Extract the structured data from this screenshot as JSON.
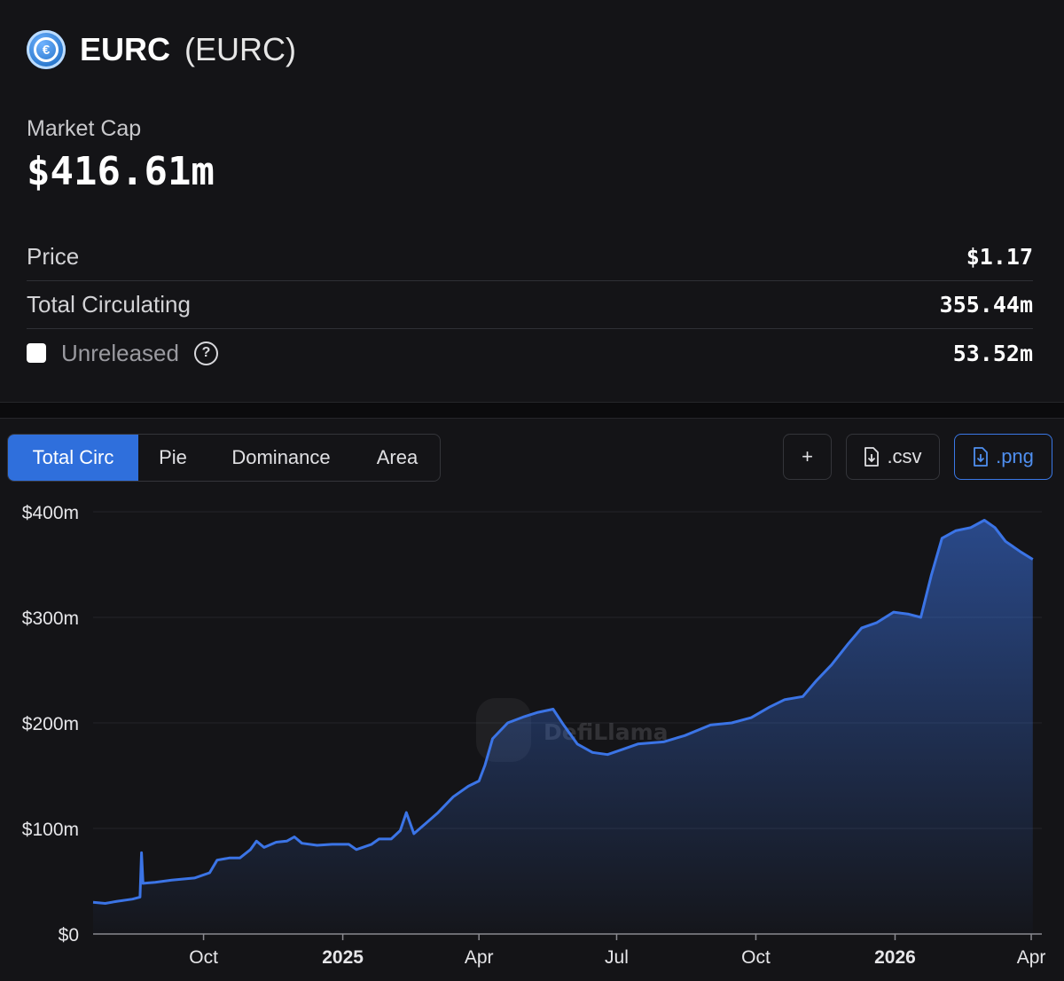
{
  "header": {
    "name": "EURC",
    "symbol": "(EURC)",
    "logo_glyph": "€",
    "brand_color": "#2775ca"
  },
  "market_cap": {
    "label": "Market Cap",
    "value": "$416.61m"
  },
  "stats": {
    "price": {
      "label": "Price",
      "value": "$1.17"
    },
    "total_circulating": {
      "label": "Total Circulating",
      "value": "355.44m"
    },
    "unreleased": {
      "label": "Unreleased",
      "value": "53.52m",
      "checked": false,
      "help_icon": "question-circle-icon"
    }
  },
  "tabs": [
    {
      "label": "Total Circ",
      "active": true
    },
    {
      "label": "Pie",
      "active": false
    },
    {
      "label": "Dominance",
      "active": false
    },
    {
      "label": "Area",
      "active": false
    }
  ],
  "actions": {
    "add_label": "+",
    "csv_label": ".csv",
    "png_label": ".png",
    "download_icon": "file-download-icon"
  },
  "watermark": "DefiLlama",
  "colors": {
    "accent": "#2f6fdc",
    "line": "#3b74e6",
    "background": "#141417"
  },
  "chart_data": {
    "type": "area",
    "ylim": [
      0,
      400
    ],
    "y_ticks": [
      "$0",
      "$100m",
      "$200m",
      "$300m",
      "$400m"
    ],
    "y_tick_values": [
      0,
      100,
      200,
      300,
      400
    ],
    "x_ticks": [
      {
        "label": "Oct",
        "date": "2024-10-01",
        "bold": false
      },
      {
        "label": "2025",
        "date": "2025-01-01",
        "bold": true
      },
      {
        "label": "Apr",
        "date": "2025-04-01",
        "bold": false
      },
      {
        "label": "Jul",
        "date": "2025-07-01",
        "bold": false
      },
      {
        "label": "Oct",
        "date": "2025-10-01",
        "bold": false
      },
      {
        "label": "2026",
        "date": "2026-01-01",
        "bold": true
      },
      {
        "label": "Apr",
        "date": "2026-04-01",
        "bold": false
      }
    ],
    "grid": true,
    "series": [
      {
        "values": [
          [
            "2024-07-20",
            30
          ],
          [
            "2024-07-28",
            29
          ],
          [
            "2024-08-05",
            31
          ],
          [
            "2024-08-15",
            33
          ],
          [
            "2024-08-20",
            35
          ],
          [
            "2024-08-21",
            77
          ],
          [
            "2024-08-22",
            48
          ],
          [
            "2024-08-30",
            49
          ],
          [
            "2024-09-10",
            51
          ],
          [
            "2024-09-25",
            53
          ],
          [
            "2024-10-05",
            58
          ],
          [
            "2024-10-10",
            70
          ],
          [
            "2024-10-18",
            72
          ],
          [
            "2024-10-25",
            72
          ],
          [
            "2024-11-01",
            80
          ],
          [
            "2024-11-05",
            88
          ],
          [
            "2024-11-10",
            82
          ],
          [
            "2024-11-18",
            87
          ],
          [
            "2024-11-25",
            88
          ],
          [
            "2024-11-30",
            92
          ],
          [
            "2024-12-05",
            86
          ],
          [
            "2024-12-15",
            84
          ],
          [
            "2024-12-25",
            85
          ],
          [
            "2025-01-05",
            85
          ],
          [
            "2025-01-10",
            80
          ],
          [
            "2025-01-20",
            85
          ],
          [
            "2025-01-25",
            90
          ],
          [
            "2025-02-02",
            90
          ],
          [
            "2025-02-08",
            98
          ],
          [
            "2025-02-12",
            115
          ],
          [
            "2025-02-17",
            95
          ],
          [
            "2025-02-25",
            105
          ],
          [
            "2025-03-05",
            115
          ],
          [
            "2025-03-15",
            130
          ],
          [
            "2025-03-25",
            140
          ],
          [
            "2025-04-01",
            145
          ],
          [
            "2025-04-05",
            160
          ],
          [
            "2025-04-10",
            185
          ],
          [
            "2025-04-20",
            200
          ],
          [
            "2025-05-01",
            206
          ],
          [
            "2025-05-10",
            210
          ],
          [
            "2025-05-20",
            213
          ],
          [
            "2025-05-27",
            198
          ],
          [
            "2025-06-05",
            180
          ],
          [
            "2025-06-15",
            172
          ],
          [
            "2025-06-25",
            170
          ],
          [
            "2025-07-05",
            175
          ],
          [
            "2025-07-15",
            180
          ],
          [
            "2025-08-01",
            182
          ],
          [
            "2025-08-15",
            188
          ],
          [
            "2025-09-01",
            198
          ],
          [
            "2025-09-15",
            200
          ],
          [
            "2025-09-28",
            205
          ],
          [
            "2025-10-10",
            215
          ],
          [
            "2025-10-20",
            222
          ],
          [
            "2025-11-01",
            225
          ],
          [
            "2025-11-10",
            240
          ],
          [
            "2025-11-20",
            255
          ],
          [
            "2025-12-01",
            275
          ],
          [
            "2025-12-10",
            290
          ],
          [
            "2025-12-20",
            295
          ],
          [
            "2025-12-31",
            305
          ],
          [
            "2026-01-10",
            303
          ],
          [
            "2026-01-18",
            300
          ],
          [
            "2026-01-25",
            340
          ],
          [
            "2026-02-01",
            375
          ],
          [
            "2026-02-10",
            382
          ],
          [
            "2026-02-20",
            385
          ],
          [
            "2026-03-01",
            392
          ],
          [
            "2026-03-08",
            385
          ],
          [
            "2026-03-15",
            372
          ],
          [
            "2026-03-25",
            362
          ],
          [
            "2026-04-02",
            355
          ]
        ]
      }
    ]
  }
}
